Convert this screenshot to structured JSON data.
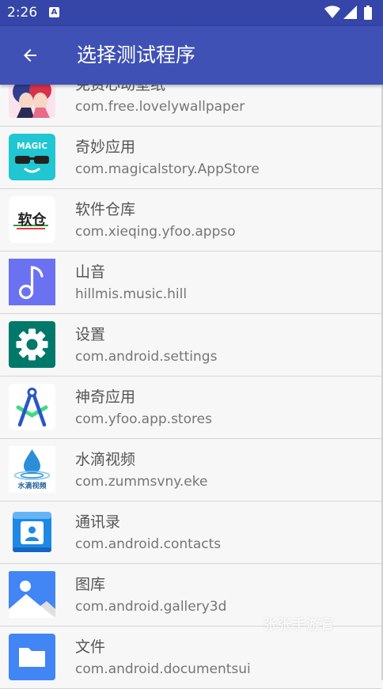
{
  "status_bar": {
    "time": "2:26",
    "notification_glyph": "A",
    "icons": [
      "wifi-icon",
      "signal-icon",
      "battery-icon"
    ]
  },
  "app_bar": {
    "title": "选择测试程序",
    "back_icon": "arrow-back-icon"
  },
  "apps": [
    {
      "name": "免费心动壁纸",
      "package": "com.free.lovelywallpaper",
      "icon": "lovely-wallpaper-icon"
    },
    {
      "name": "奇妙应用",
      "package": "com.magicalstory.AppStore",
      "icon": "magic-app-icon",
      "icon_text": "MAGIC"
    },
    {
      "name": "软件仓库",
      "package": "com.xieqing.yfoo.appso",
      "icon": "software-warehouse-icon",
      "icon_text": "软仓"
    },
    {
      "name": "山音",
      "package": "hillmis.music.hill",
      "icon": "music-note-icon"
    },
    {
      "name": "设置",
      "package": "com.android.settings",
      "icon": "settings-gear-icon"
    },
    {
      "name": "神奇应用",
      "package": "com.yfoo.app.stores",
      "icon": "compass-app-icon"
    },
    {
      "name": "水滴视频",
      "package": "com.zummsvny.eke",
      "icon": "water-drop-video-icon",
      "icon_text": "水滴视频"
    },
    {
      "name": "通讯录",
      "package": "com.android.contacts",
      "icon": "contacts-icon"
    },
    {
      "name": "图库",
      "package": "com.android.gallery3d",
      "icon": "gallery-icon"
    },
    {
      "name": "文件",
      "package": "com.android.documentsui",
      "icon": "files-folder-icon"
    }
  ],
  "watermark": "张张手游官",
  "colors": {
    "status_bar": "#3546a8",
    "app_bar": "#3f51b5",
    "background": "#f7f7f7",
    "divider": "#d4d4d4",
    "primary_text": "#555555",
    "secondary_text": "#757575"
  }
}
